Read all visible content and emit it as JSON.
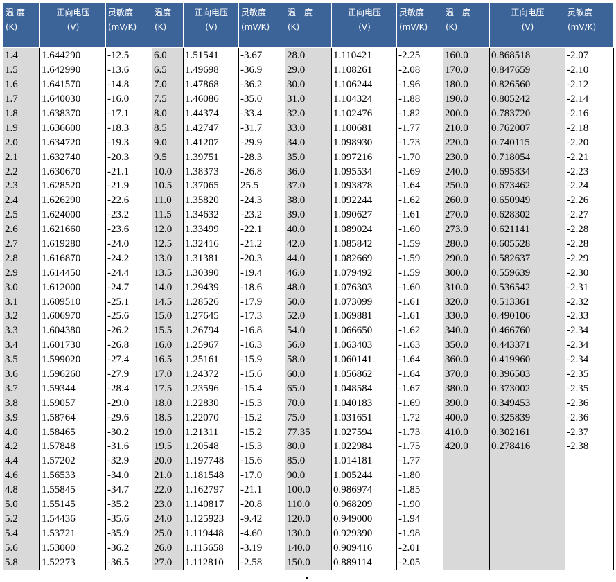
{
  "headers": [
    {
      "line1": "温 度",
      "line2": "(K)"
    },
    {
      "line1": "正向电压",
      "line2": "(V)"
    },
    {
      "line1": "灵敏度",
      "line2": "(mV/K)"
    },
    {
      "line1": "温度",
      "line2": "(K)"
    },
    {
      "line1": "正向电压",
      "line2": "(V)"
    },
    {
      "line1": "灵敏度",
      "line2": "(mV/K)"
    },
    {
      "line1": "温　度",
      "line2": "(K)"
    },
    {
      "line1": "正向电压",
      "line2": "(V)"
    },
    {
      "line1": "灵敏度",
      "line2": "(mV/K)"
    },
    {
      "line1": "温　度",
      "line2": "(K)"
    },
    {
      "line1": "正向电压",
      "line2": "(V)"
    },
    {
      "line1": "灵敏度",
      "line2": "(mV/K)"
    }
  ],
  "rows": [
    [
      "1.4",
      "1.644290",
      "-12.5",
      "6.0",
      "1.51541",
      "-3.67",
      "28.0",
      "1.110421",
      "-2.25",
      "160.0",
      "0.868518",
      "-2.07"
    ],
    [
      "1.5",
      "1.642990",
      "-13.6",
      "6.5",
      "1.49698",
      "-36.9",
      "29.0",
      "1.108261",
      "-2.08",
      "170.0",
      "0.847659",
      "-2.10"
    ],
    [
      "1.6",
      "1.641570",
      "-14.8",
      "7.0",
      "1.47868",
      "-36.2",
      "30.0",
      "1.106244",
      "-1.96",
      "180.0",
      "0.826560",
      "-2.12"
    ],
    [
      "1.7",
      "1.640030",
      "-16.0",
      "7.5",
      "1.46086",
      "-35.0",
      "31.0",
      "1.104324",
      "-1.88",
      "190.0",
      "0.805242",
      "-2.14"
    ],
    [
      "1.8",
      "1.638370",
      "-17.1",
      "8.0",
      "1.44374",
      "-33.4",
      "32.0",
      "1.102476",
      "-1.82",
      "200.0",
      "0.783720",
      "-2.16"
    ],
    [
      "1.9",
      "1.636600",
      "-18.3",
      "8.5",
      "1.42747",
      "-31.7",
      "33.0",
      "1.100681",
      "-1.77",
      "210.0",
      "0.762007",
      "-2.18"
    ],
    [
      "2.0",
      "1.634720",
      "-19.3",
      "9.0",
      "1.41207",
      "-29.9",
      "34.0",
      "1.098930",
      "-1.73",
      "220.0",
      "0.740115",
      "-2.20"
    ],
    [
      "2.1",
      "1.632740",
      "-20.3",
      "9.5",
      "1.39751",
      "-28.3",
      "35.0",
      "1.097216",
      "-1.70",
      "230.0",
      "0.718054",
      "-2.21"
    ],
    [
      "2.2",
      "1.630670",
      "-21.1",
      "10.0",
      "1.38373",
      "-26.8",
      "36.0",
      "1.095534",
      "-1.69",
      "240.0",
      "0.695834",
      "-2.23"
    ],
    [
      "2.3",
      "1.628520",
      "-21.9",
      "10.5",
      "1.37065",
      "25.5",
      "37.0",
      "1.093878",
      "-1.64",
      "250.0",
      "0.673462",
      "-2.24"
    ],
    [
      "2.4",
      "1.626290",
      "-22.6",
      "11.0",
      "1.35820",
      "-24.3",
      "38.0",
      "1.092244",
      "-1.62",
      "260.0",
      "0.650949",
      "-2.26"
    ],
    [
      "2.5",
      "1.624000",
      "-23.2",
      "11.5",
      "1.34632",
      "-23.2",
      "39.0",
      "1.090627",
      "-1.61",
      "270.0",
      "0.628302",
      "-2.27"
    ],
    [
      "2.6",
      "1.621660",
      "-23.6",
      "12.0",
      "1.33499",
      "-22.1",
      "40.0",
      "1.089024",
      "-1.60",
      "273.0",
      "0.621141",
      "-2.28"
    ],
    [
      "2.7",
      "1.619280",
      "-24.0",
      "12.5",
      "1.32416",
      "-21.2",
      "42.0",
      "1.085842",
      "-1.59",
      "280.0",
      "0.605528",
      "-2.28"
    ],
    [
      "2.8",
      "1.616870",
      "-24.2",
      "13.0",
      "1.31381",
      "-20.3",
      "44.0",
      "1.082669",
      "-1.59",
      "290.0",
      "0.582637",
      "-2.29"
    ],
    [
      "2.9",
      "1.614450",
      "-24.4",
      "13.5",
      "1.30390",
      "-19.4",
      "46.0",
      "1.079492",
      "-1.59",
      "300.0",
      "0.559639",
      "-2.30"
    ],
    [
      "3.0",
      "1.612000",
      "-24.7",
      "14.0",
      "1.29439",
      "-18.6",
      "48.0",
      "1.076303",
      "-1.60",
      "310.0",
      "0.536542",
      "-2.31"
    ],
    [
      "3.1",
      "1.609510",
      "-25.1",
      "14.5",
      "1.28526",
      "-17.9",
      "50.0",
      "1.073099",
      "-1.61",
      "320.0",
      "0.513361",
      "-2.32"
    ],
    [
      "3.2",
      "1.606970",
      "-25.6",
      "15.0",
      "1.27645",
      "-17.3",
      "52.0",
      "1.069881",
      "-1.61",
      "330.0",
      "0.490106",
      "-2.33"
    ],
    [
      "3.3",
      "1.604380",
      "-26.2",
      "15.5",
      "1.26794",
      "-16.8",
      "54.0",
      "1.066650",
      "-1.62",
      "340.0",
      "0.466760",
      "-2.34"
    ],
    [
      "3.4",
      "1.601730",
      "-26.8",
      "16.0",
      "1.25967",
      "-16.3",
      "56.0",
      "1.063403",
      "-1.63",
      "350.0",
      "0.443371",
      "-2.34"
    ],
    [
      "3.5",
      "1.599020",
      "-27.4",
      "16.5",
      "1.25161",
      "-15.9",
      "58.0",
      "1.060141",
      "-1.64",
      "360.0",
      "0.419960",
      "-2.34"
    ],
    [
      "3.6",
      "1.596260",
      "-27.9",
      "17.0",
      "1.24372",
      "-15.6",
      "60.0",
      "1.056862",
      "-1.64",
      "370.0",
      "0.396503",
      "-2.35"
    ],
    [
      "3.7",
      "1.59344",
      "-28.4",
      "17.5",
      "1.23596",
      "-15.4",
      "65.0",
      "1.048584",
      "-1.67",
      "380.0",
      "0.373002",
      "-2.35"
    ],
    [
      "3.8",
      "1.59057",
      "-29.0",
      "18.0",
      "1.22830",
      "-15.3",
      "70.0",
      "1.040183",
      "-1.69",
      "390.0",
      "0.349453",
      "-2.36"
    ],
    [
      "3.9",
      "1.58764",
      "-29.6",
      "18.5",
      "1.22070",
      "-15.2",
      "75.0",
      "1.031651",
      "-1.72",
      "400.0",
      "0.325839",
      "-2.36"
    ],
    [
      "4.0",
      "1.58465",
      "-30.2",
      "19.0",
      "1.21311",
      "-15.2",
      "77.35",
      "1.027594",
      "-1.73",
      "410.0",
      "0.302161",
      "-2.37"
    ],
    [
      "4.2",
      "1.57848",
      "-31.6",
      "19.5",
      "1.20548",
      "-15.3",
      "80.0",
      "1.022984",
      "-1.75",
      "420.0",
      "0.278416",
      "-2.38"
    ],
    [
      "4.4",
      "1.57202",
      "-32.9",
      "20.0",
      "1.197748",
      "-15.6",
      "85.0",
      "1.014181",
      "-1.77",
      "",
      "",
      ""
    ],
    [
      "4.6",
      "1.56533",
      "-34.0",
      "21.0",
      "1.181548",
      "-17.0",
      "90.0",
      "1.005244",
      "-1.80",
      "",
      "",
      ""
    ],
    [
      "4.8",
      "1.55845",
      "-34.7",
      "22.0",
      "1.162797",
      "-21.1",
      "100.0",
      "0.986974",
      "-1.85",
      "",
      "",
      ""
    ],
    [
      "5.0",
      "1.55145",
      "-35.2",
      "23.0",
      "1.140817",
      "-20.8",
      "110.0",
      "0.968209",
      "-1.90",
      "",
      "",
      ""
    ],
    [
      "5.2",
      "1.54436",
      "-35.6",
      "24.0",
      "1.125923",
      "-9.42",
      "120.0",
      "0.949000",
      "-1.94",
      "",
      "",
      ""
    ],
    [
      "5.4",
      "1.53721",
      "-35.9",
      "25.0",
      "1.119448",
      "-4.60",
      "130.0",
      "0.929390",
      "-1.98",
      "",
      "",
      ""
    ],
    [
      "5.6",
      "1.53000",
      "-36.2",
      "26.0",
      "1.115658",
      "-3.19",
      "140.0",
      "0.909416",
      "-2.01",
      "",
      "",
      ""
    ],
    [
      "5.8",
      "1.52273",
      "-36.5",
      "27.0",
      "1.112810",
      "-2.58",
      "150.0",
      "0.889114",
      "-2.05",
      "",
      "",
      ""
    ]
  ]
}
